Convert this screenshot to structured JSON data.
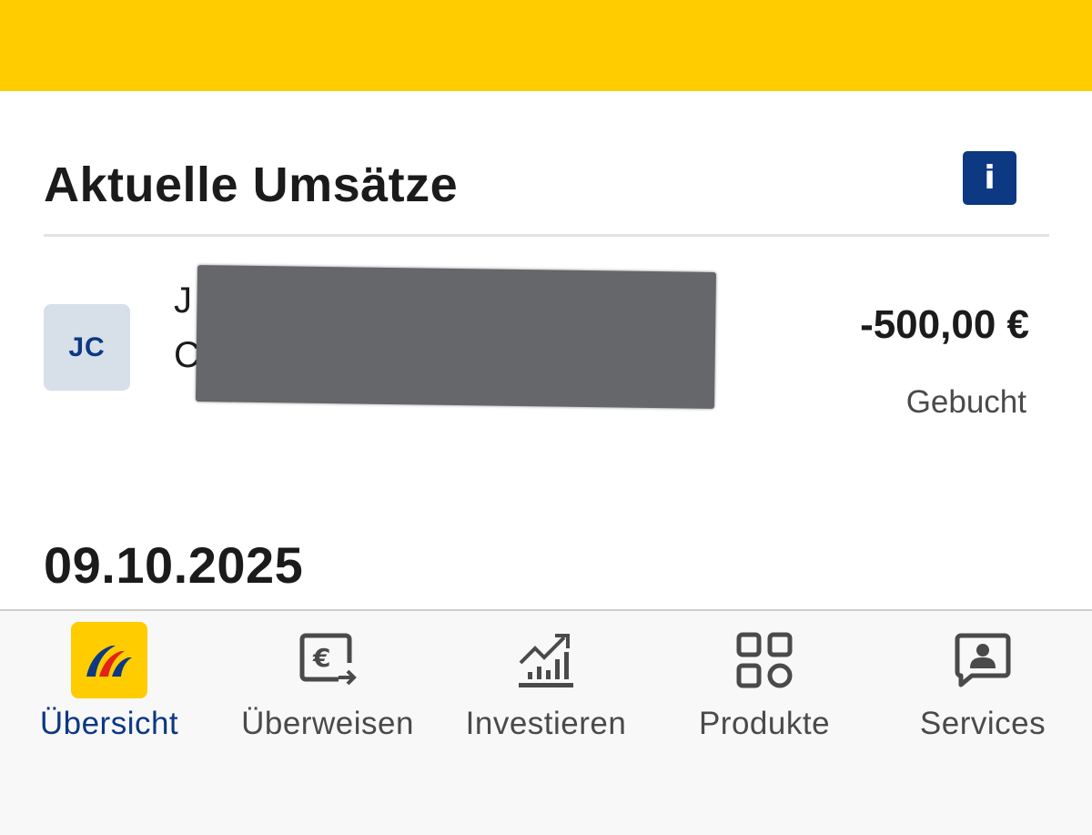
{
  "section": {
    "title": "Aktuelle Umsätze",
    "info_icon": "info-icon",
    "info_glyph": "i"
  },
  "transaction": {
    "initials": "JC",
    "line1_visible": "J",
    "line2_visible": "C",
    "amount": "-500,00 €",
    "status": "Gebucht"
  },
  "date_group": "09.10.2025",
  "nav": {
    "items": [
      {
        "label": "Übersicht",
        "icon": "postbank-logo-icon",
        "active": true
      },
      {
        "label": "Überweisen",
        "icon": "euro-transfer-icon",
        "active": false
      },
      {
        "label": "Investieren",
        "icon": "chart-growth-icon",
        "active": false
      },
      {
        "label": "Produkte",
        "icon": "grid-products-icon",
        "active": false
      },
      {
        "label": "Services",
        "icon": "service-person-chat-icon",
        "active": false
      }
    ]
  },
  "colors": {
    "brand_yellow": "#ffcc00",
    "brand_blue": "#0d3882",
    "avatar_bg": "#d7dfe9",
    "nav_icon": "#4a4a4a",
    "redaction": "#66676b"
  }
}
